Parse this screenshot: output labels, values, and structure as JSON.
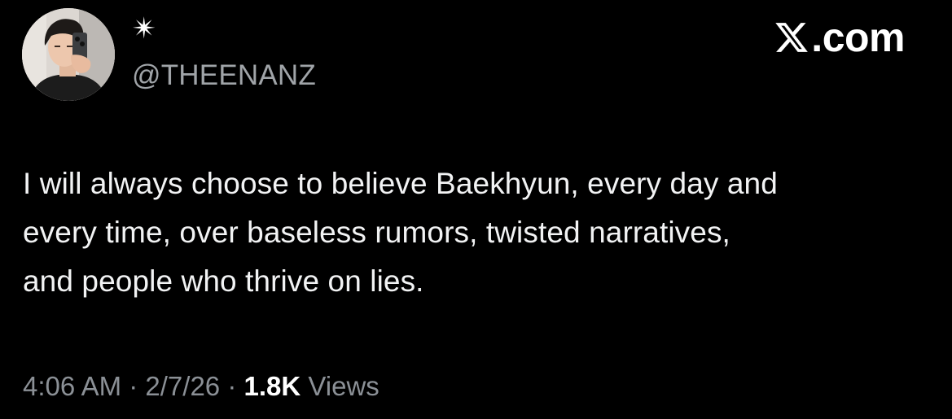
{
  "profile": {
    "display_name": "✴",
    "handle": "@THEENANZ",
    "avatar_icon": "profile-photo"
  },
  "brand": {
    "logo_icon": "x-logo-icon",
    "text": ".com"
  },
  "tweet": {
    "lines": [
      "I will always choose to believe Baekhyun, every day and",
      "every time, over baseless rumors, twisted narratives,",
      "and people who thrive on lies."
    ]
  },
  "meta": {
    "time": "4:06 AM",
    "separator": " · ",
    "date": "2/7/26",
    "views_count": "1.8K",
    "views_label": " Views"
  },
  "colors": {
    "background": "#000000",
    "text": "#f2f3f4",
    "secondary": "#8b9096"
  }
}
